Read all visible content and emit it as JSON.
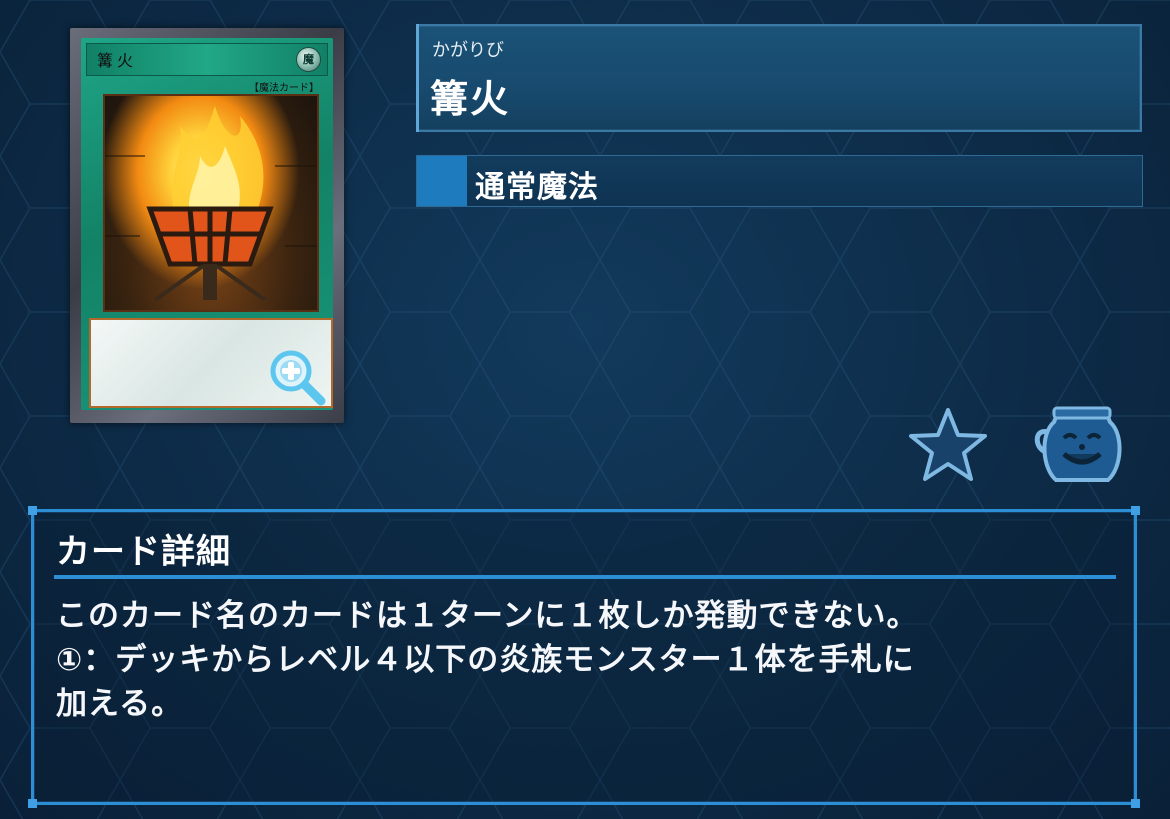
{
  "card": {
    "name_on_card": "篝火",
    "type_on_card": "【魔法カード】",
    "attribute_glyph": "魔"
  },
  "header": {
    "furigana": "かがりび",
    "title": "篝火"
  },
  "type": {
    "label": "通常魔法"
  },
  "icons": {
    "zoom": "zoom-in-magnifier",
    "favorite": "star",
    "pot": "pot-of-greed"
  },
  "details": {
    "heading": "カード詳細",
    "text": "このカード名のカードは１ターンに１枚しか発動できない。\n①：デッキからレベル４以下の炎族モンスター１体を手札に\n加える。"
  },
  "colors": {
    "accent": "#2c8fd6",
    "panel": "#174a6e",
    "card_frame": "#1fa587"
  }
}
